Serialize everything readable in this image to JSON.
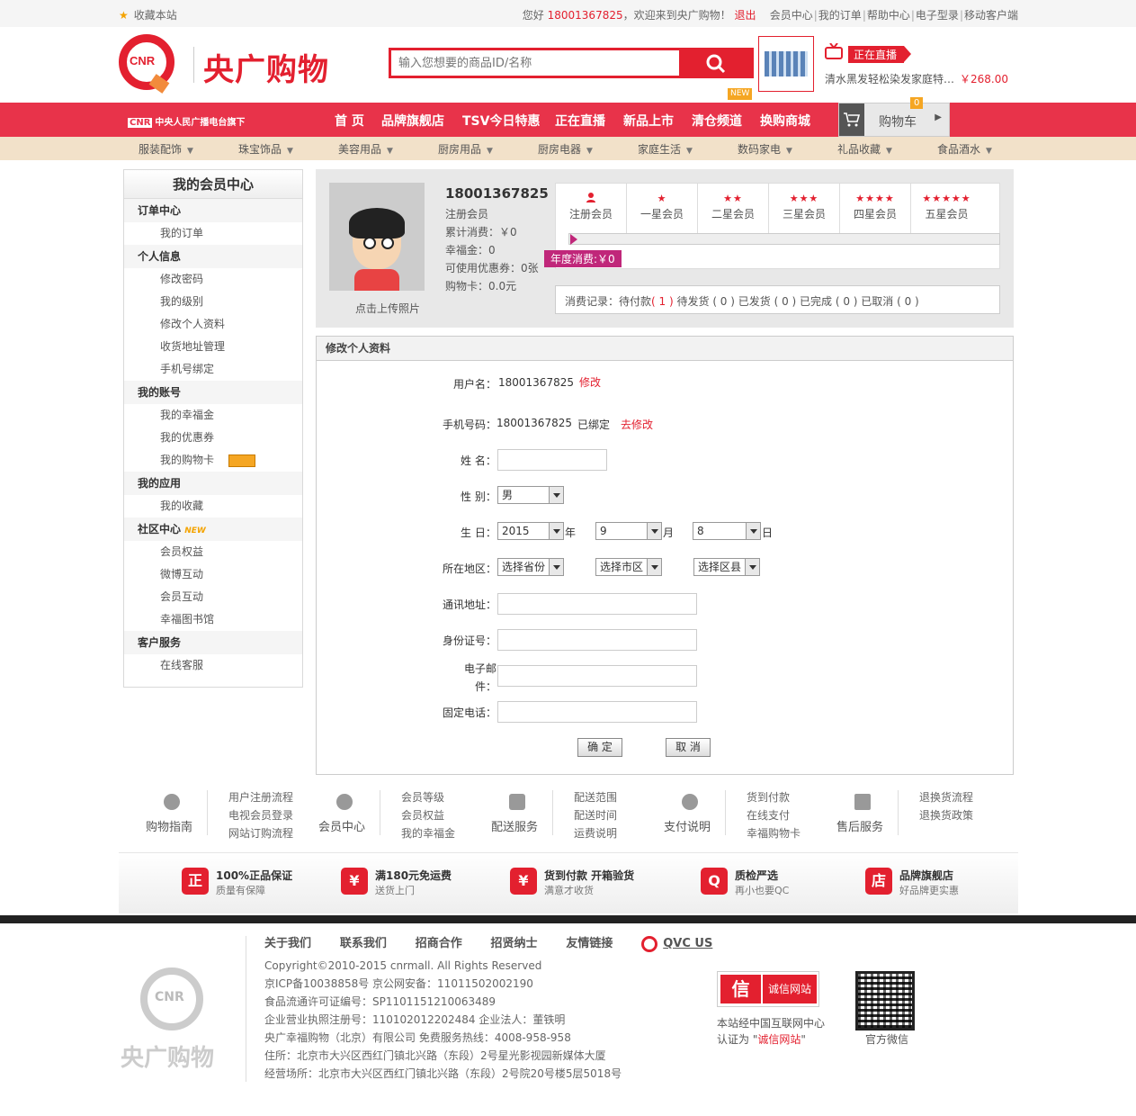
{
  "topbar": {
    "favorite": "收藏本站",
    "greeting_pre": "您好",
    "phone": "18001367825",
    "greeting_post": "，欢迎来到央广购物！",
    "logout": "退出",
    "links": [
      "会员中心",
      "我的订单",
      "帮助中心",
      "电子型录",
      "移动客户端"
    ]
  },
  "header": {
    "logo_badge": "CNR",
    "logo_text": "央广购物",
    "search_placeholder": "输入您想要的商品ID/名称",
    "live_tag": "正在直播",
    "live_product": "清水黑发轻松染发家庭特…",
    "live_price": "￥268.00"
  },
  "nav": {
    "brand_badge": "CNR",
    "brand": "中央人民广播电台旗下",
    "items": [
      "首 页",
      "品牌旗舰店",
      "TSV今日特惠",
      "正在直播",
      "新品上市",
      "清仓频道",
      "换购商城"
    ],
    "new_badge": "NEW",
    "cart_label": "购物车",
    "cart_count": "0"
  },
  "categories": [
    "服装配饰",
    "珠宝饰品",
    "美容用品",
    "厨房用品",
    "厨房电器",
    "家庭生活",
    "数码家电",
    "礼品收藏",
    "食品酒水"
  ],
  "sidebar": {
    "title": "我的会员中心",
    "groups": [
      {
        "label": "订单中心",
        "items": [
          "我的订单"
        ]
      },
      {
        "label": "个人信息",
        "items": [
          "修改密码",
          "我的级别",
          "修改个人资料",
          "收货地址管理",
          "手机号绑定"
        ]
      },
      {
        "label": "我的账号",
        "items": [
          "我的幸福金",
          "我的优惠券",
          "我的购物卡"
        ]
      },
      {
        "label": "我的应用",
        "items": [
          "我的收藏"
        ]
      },
      {
        "label": "社区中心",
        "new": "NEW",
        "items": [
          "会员权益",
          "微博互动",
          "会员互动",
          "幸福图书馆"
        ]
      },
      {
        "label": "客户服务",
        "items": [
          "在线客服"
        ]
      }
    ]
  },
  "profile": {
    "upload": "点击上传照片",
    "username": "18001367825",
    "lines": [
      "注册会员",
      "累计消费：￥0",
      "幸福金：0",
      "可使用优惠券：0张",
      "购物卡：0.0元"
    ],
    "levels": [
      {
        "stars": "",
        "name": "注册会员"
      },
      {
        "stars": "★",
        "name": "一星会员"
      },
      {
        "stars": "★★",
        "name": "二星会员"
      },
      {
        "stars": "★★★",
        "name": "三星会员"
      },
      {
        "stars": "★★★★",
        "name": "四星会员"
      },
      {
        "stars": "★★★★★",
        "name": "五星会员"
      }
    ],
    "yearly": "年度消费:￥0",
    "orders": {
      "label": "消费记录：",
      "pending_pay": "待付款",
      "pending_pay_count": "( 1 )",
      "rest": "待发货 ( 0 ) 已发货 ( 0 ) 已完成 ( 0 ) 已取消 ( 0 )"
    }
  },
  "form": {
    "title": "修改个人资料",
    "username_label": "用户名：",
    "username_value": "18001367825",
    "username_edit": "修改",
    "phone_label": "手机号码：",
    "phone_value": "18001367825",
    "phone_status": "已绑定",
    "phone_edit": "去修改",
    "name_label": "姓 名：",
    "gender_label": "性 别：",
    "gender_value": "男",
    "birthday_label": "生 日：",
    "year": "2015",
    "year_unit": "年",
    "month": "9",
    "month_unit": "月",
    "day": "8",
    "day_unit": "日",
    "region_label": "所在地区：",
    "province": "选择省份",
    "city": "选择市区",
    "district": "选择区县",
    "address_label": "通讯地址：",
    "idcard_label": "身份证号：",
    "email_label_1": "电子邮",
    "email_label_2": "件：",
    "tel_label": "固定电话：",
    "confirm": "确 定",
    "cancel": "取 消"
  },
  "help": [
    {
      "title": "购物指南",
      "links": [
        "用户注册流程",
        "电视会员登录",
        "网站订购流程"
      ]
    },
    {
      "title": "会员中心",
      "links": [
        "会员等级",
        "会员权益",
        "我的幸福金"
      ]
    },
    {
      "title": "配送服务",
      "links": [
        "配送范围",
        "配送时间",
        "运费说明"
      ]
    },
    {
      "title": "支付说明",
      "links": [
        "货到付款",
        "在线支付",
        "幸福购物卡"
      ]
    },
    {
      "title": "售后服务",
      "links": [
        "退换货流程",
        "退换货政策"
      ]
    }
  ],
  "guarantees": [
    {
      "icon": "正",
      "t1": "100%正品保证",
      "t2": "质量有保障"
    },
    {
      "icon": "¥",
      "t1": "满180元免运费",
      "t2": "送货上门"
    },
    {
      "icon": "¥",
      "t1": "货到付款  开箱验货",
      "t2": "满意才收货"
    },
    {
      "icon": "Q",
      "t1": "质检严选",
      "t2": "再小也要QC"
    },
    {
      "icon": "店",
      "t1": "品牌旗舰店",
      "t2": "好品牌更实惠"
    }
  ],
  "footer": {
    "logo_badge": "CNR",
    "logo_text": "央广购物",
    "links": [
      "关于我们",
      "联系我们",
      "招商合作",
      "招贤纳士",
      "友情链接"
    ],
    "qvc": "QVC US",
    "info": [
      "Copyright©2010-2015 cnrmall. All Rights Reserved",
      "京ICP备10038858号 京公网安备：11011502002190",
      "食品流通许可证编号：SP1101151210063489",
      "企业营业执照注册号：110102012202484    企业法人：董铁明",
      "央广幸福购物（北京）有限公司 免费服务热线：4008-958-958",
      "住所：北京市大兴区西红门镇北兴路（东段）2号星光影视园新媒体大厦",
      "经营场所：北京市大兴区西红门镇北兴路（东段）2号院20号楼5层5018号"
    ],
    "trust_icon": "信",
    "trust_label": "诚信网站",
    "trust_text_1": "本站经中国互联网中心",
    "trust_text_2_pre": "认证为 \"",
    "trust_text_2_red": "诚信网站",
    "trust_text_2_post": "\"",
    "wechat": "官方微信"
  }
}
